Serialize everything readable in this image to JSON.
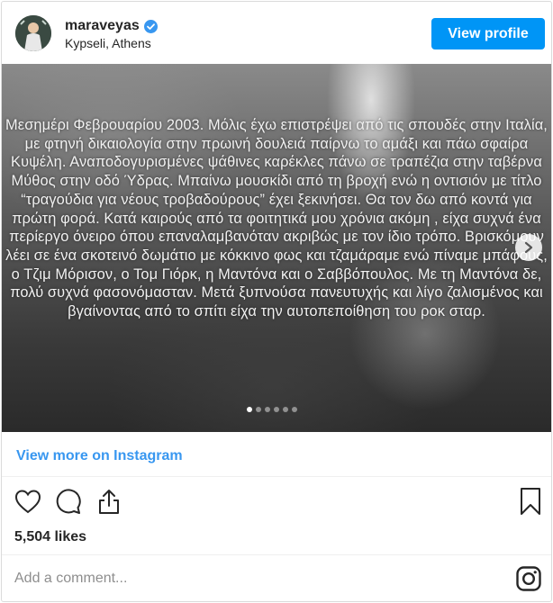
{
  "profile": {
    "username": "maraveyas",
    "location": "Kypseli, Athens",
    "view_profile_label": "View profile",
    "avatar_icon": "avatar-photo"
  },
  "post": {
    "text": "Μεσημέρι Φεβρουαρίου 2003. Μόλις έχω επιστρέψει από τις σπουδές στην Ιταλία, με φτηνή δικαιολογία στην πρωινή δουλειά παίρνω το αμάξι και πάω σφαίρα Κυψέλη. Αναποδογυρισμένες ψάθινες καρέκλες πάνω σε τραπέζια στην ταβέρνα Μύθος στην  οδό Ύδρας. Μπαίνω μουσκίδι από τη βροχή ενώ η οντισιόν με τίτλο “τραγούδια για νέους τροβαδούρους” έχει ξεκινήσει. Θα τον δω από κοντά για πρώτη φορά. Κατά καιρούς από τα φοιτητικά μου χρόνια ακόμη , είχα συχνά ένα περίεργο όνειρο όπου επαναλαμβανόταν ακριβώς με τον ίδιο τρόπο. Βρισκόμουν λέει σε ένα σκοτεινό δωμάτιο με κόκκινο φως και τζαμάραμε ενώ πίναμε μπάφους, ο Τζιμ Μόρισον, ο Τομ Γιόρκ, η Μαντόνα και ο Σαββόπουλος. Με τη Μαντόνα δε, πολύ συχνά φασονόμασταν. Μετά ξυπνούσα πανευτυχής και λίγο ζαλισμένος και βγαίνοντας από το σπίτι είχα την αυτοπεποίθηση του ροκ σταρ.",
    "carousel_total": 6,
    "carousel_active": 1
  },
  "footer": {
    "view_more_label": "View more on Instagram",
    "likes": "5,504 likes",
    "comment_placeholder": "Add a comment..."
  },
  "colors": {
    "accent": "#0095f6",
    "link": "#3897f0",
    "verified": "#3897f0"
  }
}
